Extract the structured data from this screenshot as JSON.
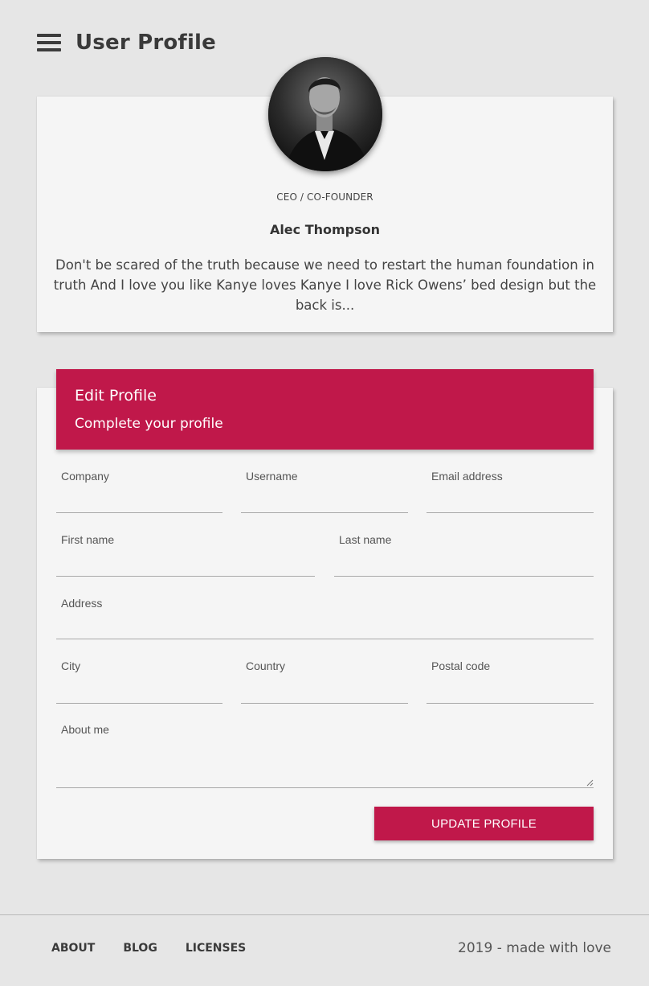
{
  "header": {
    "title": "User Profile",
    "menu_icon": "hamburger-menu-icon"
  },
  "profile": {
    "role": "CEO / CO-FOUNDER",
    "name": "Alec Thompson",
    "bio": "Don't be scared of the truth because we need to restart the human foundation in truth And I love you like Kanye loves Kanye I love Rick Owens’ bed design but the back is..."
  },
  "edit_profile": {
    "title": "Edit Profile",
    "subtitle": "Complete your profile",
    "accent_color": "#c0184a",
    "fields": {
      "company": {
        "label": "Company",
        "value": ""
      },
      "username": {
        "label": "Username",
        "value": ""
      },
      "email": {
        "label": "Email address",
        "value": ""
      },
      "first_name": {
        "label": "First name",
        "value": ""
      },
      "last_name": {
        "label": "Last name",
        "value": ""
      },
      "address": {
        "label": "Address",
        "value": ""
      },
      "city": {
        "label": "City",
        "value": ""
      },
      "country": {
        "label": "Country",
        "value": ""
      },
      "postal_code": {
        "label": "Postal code",
        "value": ""
      },
      "about_me": {
        "label": "About me",
        "value": ""
      }
    },
    "submit_label": "UPDATE PROFILE"
  },
  "footer": {
    "links": [
      "ABOUT",
      "BLOG",
      "LICENSES"
    ],
    "copyright": "2019 - made with love"
  }
}
